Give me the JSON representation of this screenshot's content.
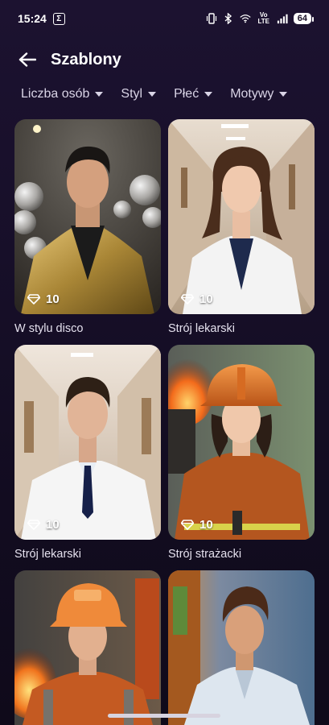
{
  "status_bar": {
    "time": "15:24",
    "sigma": "Σ",
    "volte": "Vo LTE",
    "battery": "64"
  },
  "header": {
    "title": "Szablony"
  },
  "filters": [
    {
      "label": "Liczba osób"
    },
    {
      "label": "Styl"
    },
    {
      "label": "Płeć"
    },
    {
      "label": "Motywy"
    }
  ],
  "templates": [
    {
      "title": "W stylu disco",
      "cost": "10"
    },
    {
      "title": "Strój lekarski",
      "cost": "10"
    },
    {
      "title": "Strój lekarski",
      "cost": "10"
    },
    {
      "title": "Strój strażacki",
      "cost": "10"
    },
    {
      "title": "",
      "cost": ""
    },
    {
      "title": "",
      "cost": ""
    }
  ],
  "icons": {
    "back": "arrow-left-icon",
    "cost": "diamond-icon"
  }
}
